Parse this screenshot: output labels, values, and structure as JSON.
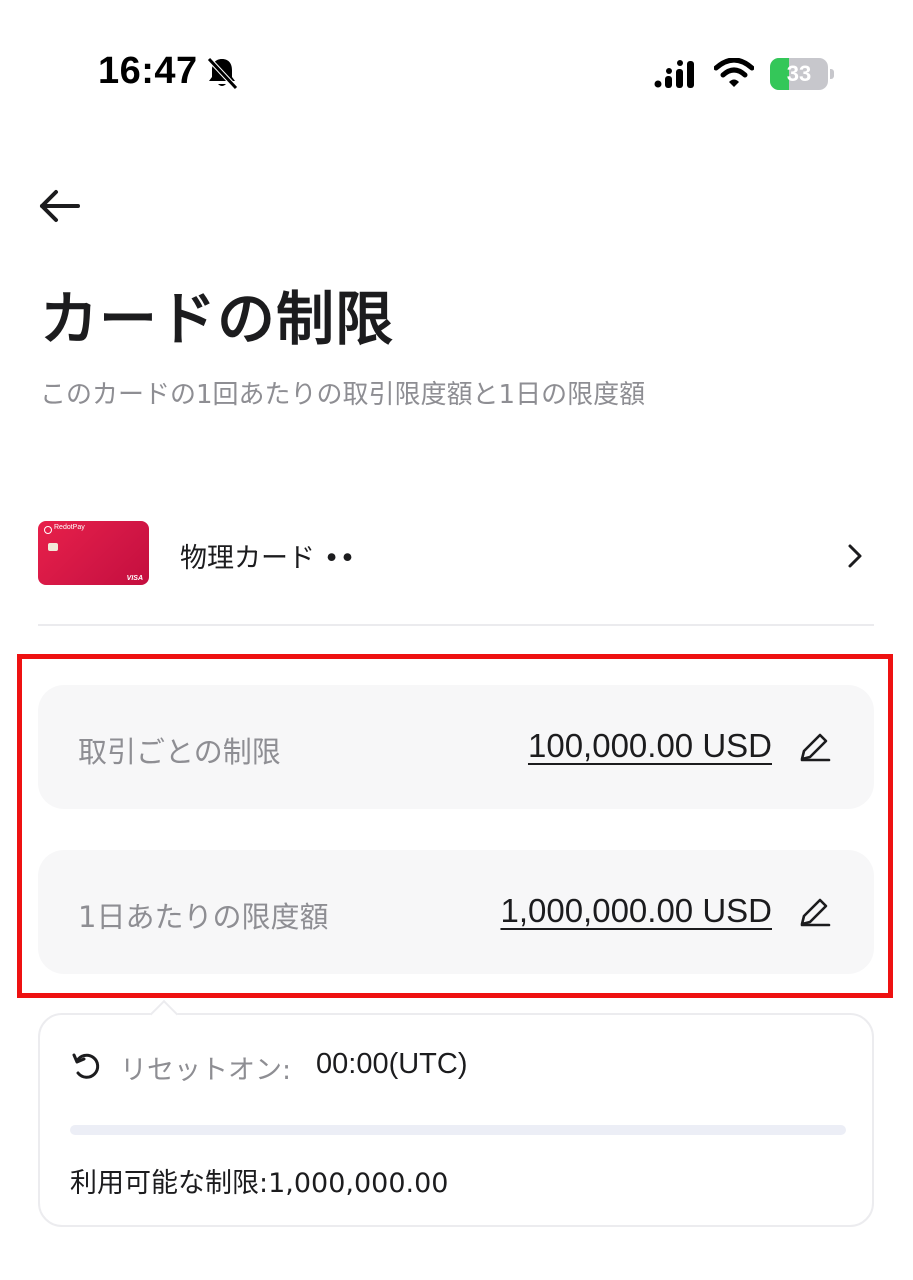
{
  "status_bar": {
    "time": "16:47",
    "battery_level": "33",
    "battery_fraction": 0.33,
    "icons": [
      "bell-slash-icon",
      "signal-icon",
      "wifi-icon",
      "battery-charging-icon"
    ]
  },
  "header": {
    "back_icon": "arrow-left-icon",
    "title": "カードの制限",
    "subtitle": "このカードの1回あたりの取引限度額と1日の限度額"
  },
  "card": {
    "brand": "RedotPay",
    "network": "VISA",
    "label": "物理カード ••",
    "color": "#e01a48"
  },
  "limits": [
    {
      "label": "取引ごとの制限",
      "value": "100,000.00 USD"
    },
    {
      "label": "1日あたりの限度額",
      "value": "1,000,000.00 USD"
    }
  ],
  "reset": {
    "label": "リセットオン:",
    "time": "00:00(UTC)",
    "usage_fraction": 0,
    "available": "利用可能な制限:1,000,000.00"
  },
  "colors": {
    "highlight": "#ee1111",
    "row_background": "#f7f7f8",
    "muted_text": "#8e8e93"
  }
}
